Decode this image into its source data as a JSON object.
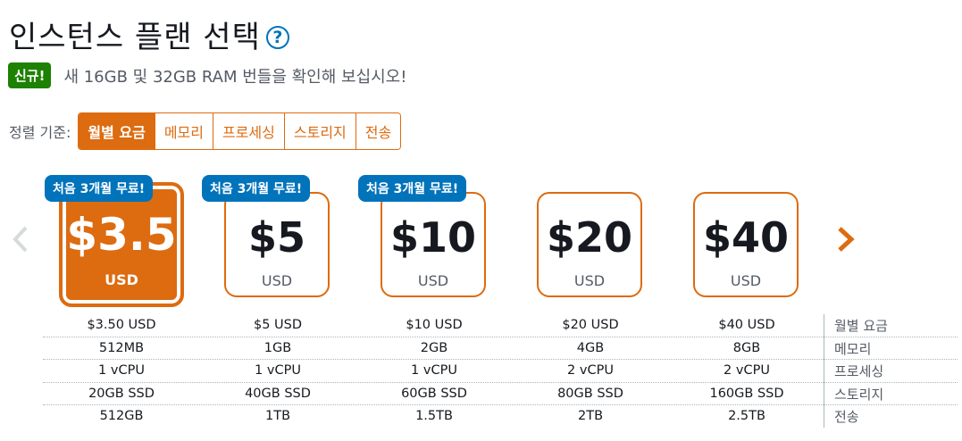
{
  "header": {
    "title": "인스턴스 플랜 선택",
    "help_icon": "question-circle-icon"
  },
  "notice": {
    "badge": "신규!",
    "text": "새 16GB 및 32GB RAM 번들을 확인해 보십시오!"
  },
  "sort": {
    "label": "정렬 기준:",
    "options": [
      "월별 요금",
      "메모리",
      "프로세싱",
      "스토리지",
      "전송"
    ],
    "selected": "월별 요금"
  },
  "nav": {
    "prev_icon": "chevron-left-icon",
    "next_icon": "chevron-right-icon"
  },
  "plans": [
    {
      "price": "$3.5",
      "currency": "USD",
      "promo": "처음 3개월 무료!",
      "selected": true
    },
    {
      "price": "$5",
      "currency": "USD",
      "promo": "처음 3개월 무료!",
      "selected": false
    },
    {
      "price": "$10",
      "currency": "USD",
      "promo": "처음 3개월 무료!",
      "selected": false
    },
    {
      "price": "$20",
      "currency": "USD",
      "promo": "",
      "selected": false
    },
    {
      "price": "$40",
      "currency": "USD",
      "promo": "",
      "selected": false
    }
  ],
  "specs": [
    {
      "label": "월별 요금",
      "values": [
        "$3.50 USD",
        "$5 USD",
        "$10 USD",
        "$20 USD",
        "$40 USD"
      ]
    },
    {
      "label": "메모리",
      "values": [
        "512MB",
        "1GB",
        "2GB",
        "4GB",
        "8GB"
      ]
    },
    {
      "label": "프로세싱",
      "values": [
        "1 vCPU",
        "1 vCPU",
        "1 vCPU",
        "2 vCPU",
        "2 vCPU"
      ]
    },
    {
      "label": "스토리지",
      "values": [
        "20GB SSD",
        "40GB SSD",
        "60GB SSD",
        "80GB SSD",
        "160GB SSD"
      ]
    },
    {
      "label": "전송",
      "values": [
        "512GB",
        "1TB",
        "1.5TB",
        "2TB",
        "2.5TB"
      ]
    }
  ],
  "colors": {
    "accent": "#dd6b10",
    "promo": "#0073bb",
    "new_badge": "#1d8102"
  }
}
